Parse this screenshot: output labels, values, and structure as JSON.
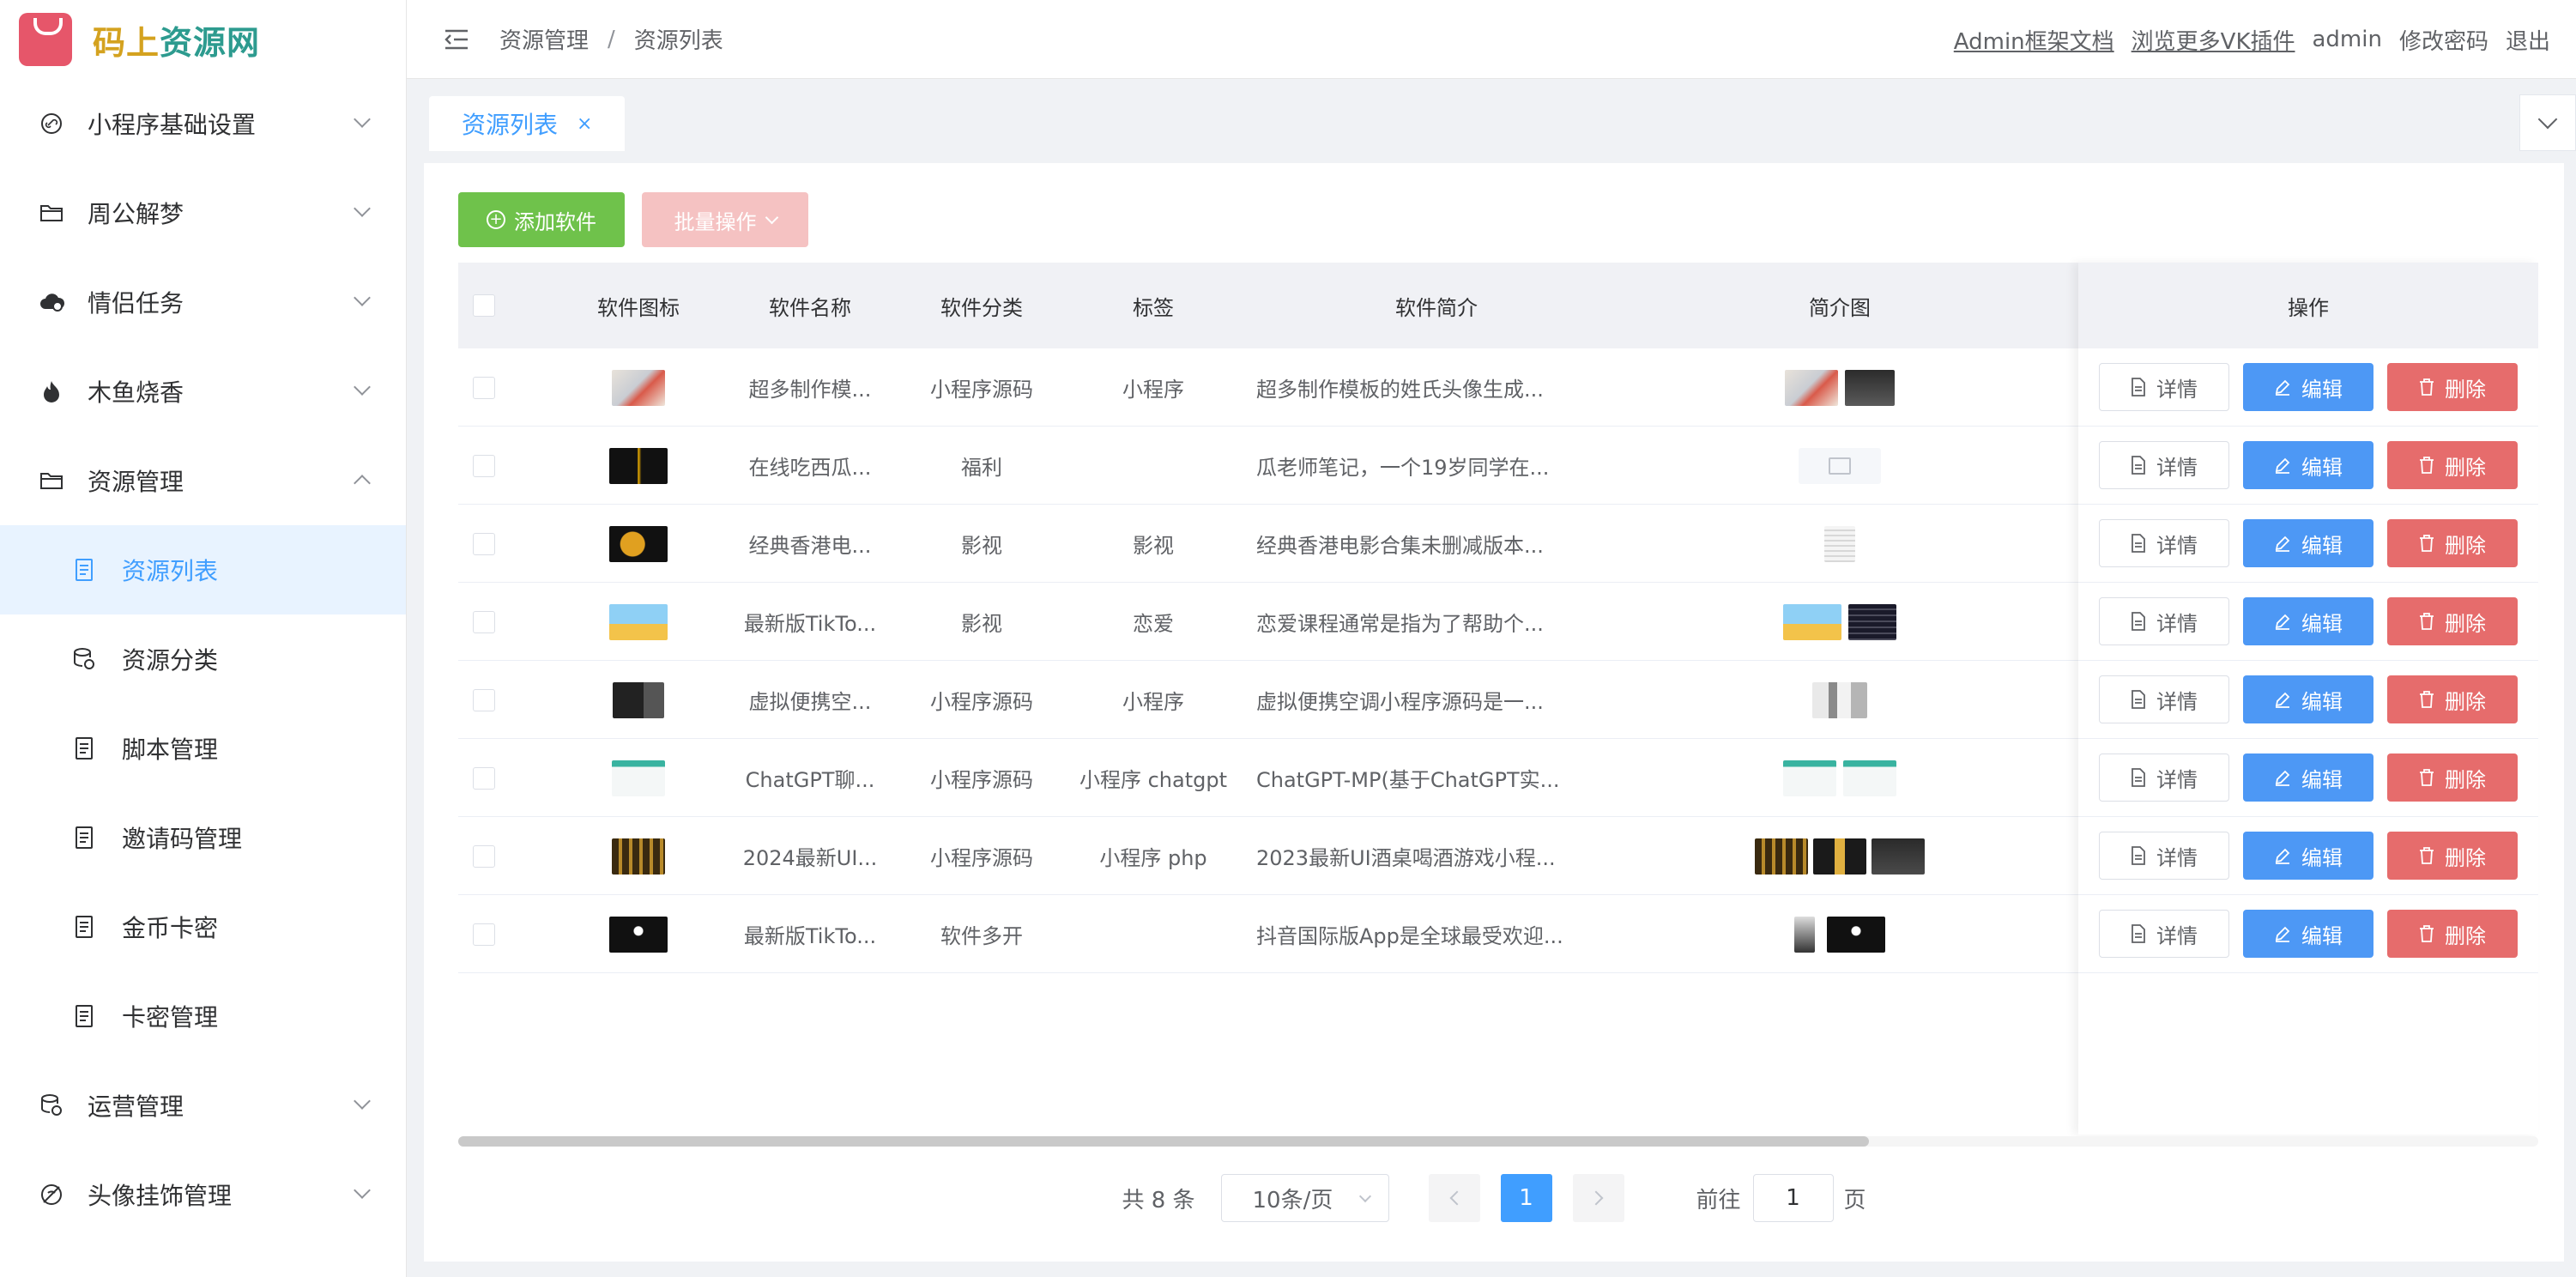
{
  "app": {
    "logo_text_a": "码上",
    "logo_text_b": "资源网"
  },
  "sidebar": {
    "items": [
      {
        "label": "小程序基础设置",
        "icon": "link-icon",
        "expanded": false
      },
      {
        "label": "周公解梦",
        "icon": "folder-icon",
        "expanded": false
      },
      {
        "label": "情侣任务",
        "icon": "cloud-icon",
        "expanded": false
      },
      {
        "label": "木鱼烧香",
        "icon": "fire-icon",
        "expanded": false
      },
      {
        "label": "资源管理",
        "icon": "folder-icon",
        "expanded": true
      },
      {
        "label": "运营管理",
        "icon": "coins-icon",
        "expanded": false
      },
      {
        "label": "头像挂饰管理",
        "icon": "no-icon",
        "expanded": false
      }
    ],
    "sub_items": [
      {
        "label": "资源列表",
        "icon": "document-icon",
        "active": true
      },
      {
        "label": "资源分类",
        "icon": "coins-icon",
        "active": false
      },
      {
        "label": "脚本管理",
        "icon": "document-icon",
        "active": false
      },
      {
        "label": "邀请码管理",
        "icon": "document-icon",
        "active": false
      },
      {
        "label": "金币卡密",
        "icon": "document-icon",
        "active": false
      },
      {
        "label": "卡密管理",
        "icon": "document-icon",
        "active": false
      }
    ]
  },
  "header": {
    "breadcrumb": [
      "资源管理",
      "资源列表"
    ],
    "links": [
      "Admin框架文档",
      "浏览更多VK插件"
    ],
    "user": "admin",
    "change_password": "修改密码",
    "logout": "退出"
  },
  "tabs": {
    "active_tab": "资源列表",
    "close_glyph": "×"
  },
  "toolbar": {
    "add_label": "添加软件",
    "batch_label": "批量操作"
  },
  "table": {
    "columns": [
      "软件图标",
      "软件名称",
      "软件分类",
      "标签",
      "软件简介",
      "简介图",
      "操作"
    ],
    "rows": [
      {
        "name": "超多制作模...",
        "category": "小程序源码",
        "tag": "小程序",
        "intro": "超多制作模板的姓氏头像生成..."
      },
      {
        "name": "在线吃西瓜...",
        "category": "福利",
        "tag": "",
        "intro": "瓜老师笔记，一个19岁同学在..."
      },
      {
        "name": "经典香港电...",
        "category": "影视",
        "tag": "影视",
        "intro": "经典香港电影合集未删减版本..."
      },
      {
        "name": "最新版TikTo...",
        "category": "影视",
        "tag": "恋爱",
        "intro": "恋爱课程通常是指为了帮助个..."
      },
      {
        "name": "虚拟便携空...",
        "category": "小程序源码",
        "tag": "小程序",
        "intro": "虚拟便携空调小程序源码是一..."
      },
      {
        "name": "ChatGPT聊...",
        "category": "小程序源码",
        "tag": "小程序 chatgpt",
        "intro": "ChatGPT-MP(基于ChatGPT实..."
      },
      {
        "name": "2024最新UI...",
        "category": "小程序源码",
        "tag": "小程序 php",
        "intro": "2023最新UI酒桌喝酒游戏小程..."
      },
      {
        "name": "最新版TikTo...",
        "category": "软件多开",
        "tag": "",
        "intro": "抖音国际版App是全球最受欢迎..."
      }
    ],
    "actions": {
      "detail": "详情",
      "edit": "编辑",
      "delete": "删除"
    }
  },
  "pagination": {
    "total_text": "共 8 条",
    "page_size": "10条/页",
    "current_page": "1",
    "goto_label": "前往",
    "goto_value": "1",
    "page_suffix": "页"
  },
  "colors": {
    "primary": "#409eff",
    "success": "#6fc24b",
    "danger": "#e66c6c",
    "edit": "#4d98f5"
  }
}
